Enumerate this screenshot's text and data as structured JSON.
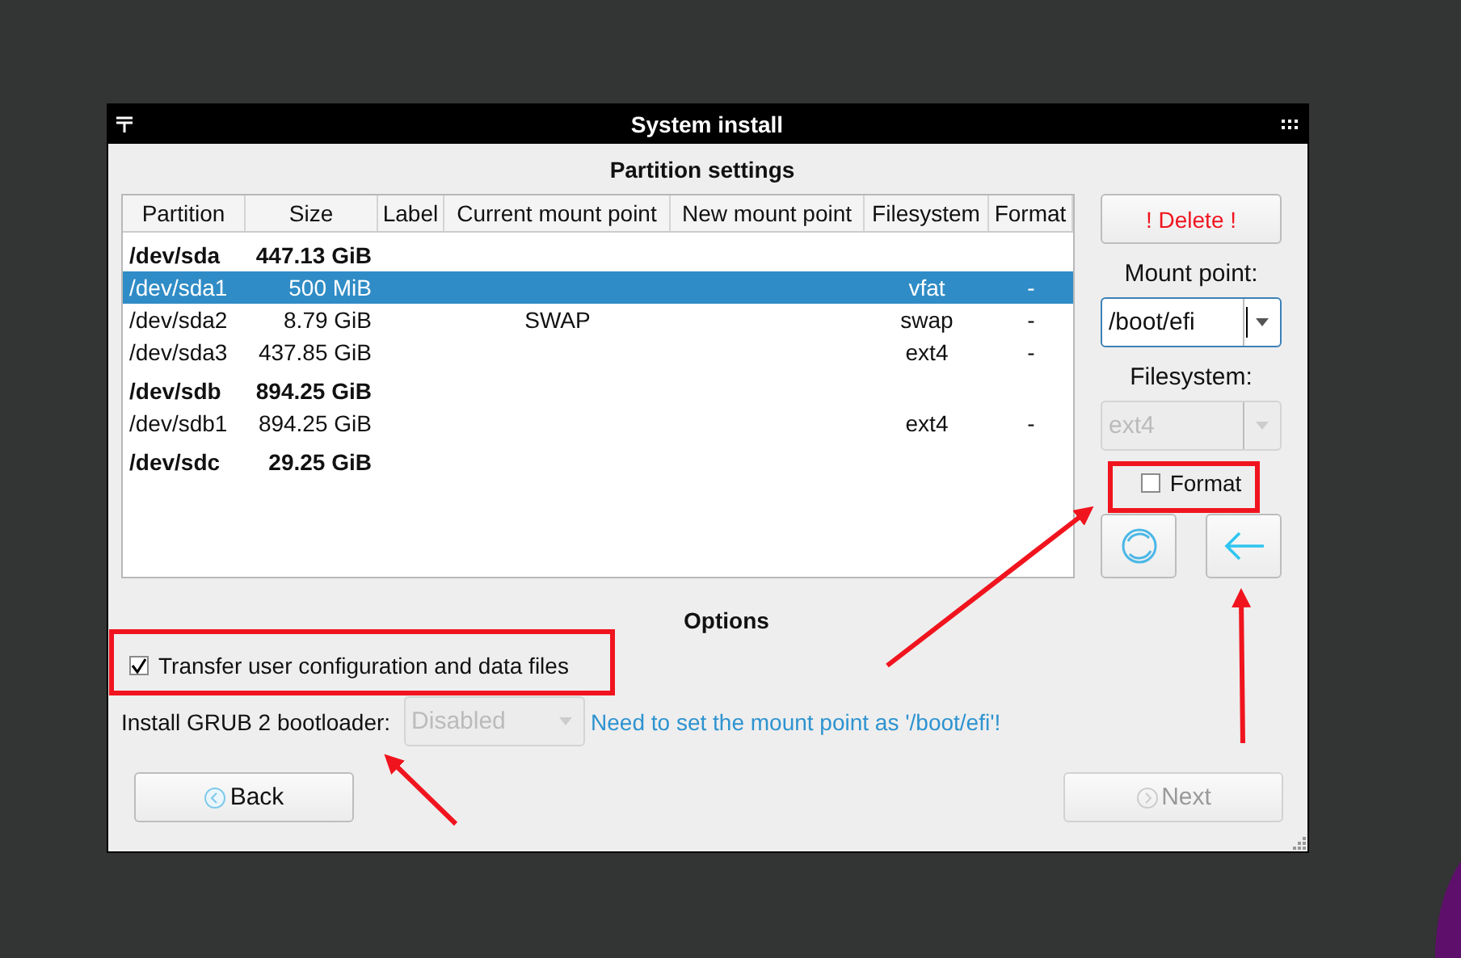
{
  "window": {
    "title": "System install"
  },
  "section_title": "Partition settings",
  "table": {
    "columns": [
      "Partition",
      "Size",
      "Label",
      "Current mount point",
      "New mount point",
      "Filesystem",
      "Format"
    ],
    "rows": [
      {
        "kind": "disk",
        "selected": false,
        "cells": [
          "/dev/sda",
          "447.13 GiB",
          "",
          "",
          "",
          "",
          ""
        ]
      },
      {
        "kind": "partition",
        "selected": true,
        "cells": [
          "/dev/sda1",
          "500 MiB",
          "",
          "",
          "",
          "vfat",
          "-"
        ]
      },
      {
        "kind": "partition",
        "selected": false,
        "cells": [
          "/dev/sda2",
          "8.79 GiB",
          "",
          "SWAP",
          "",
          "swap",
          "-"
        ]
      },
      {
        "kind": "partition",
        "selected": false,
        "cells": [
          "/dev/sda3",
          "437.85 GiB",
          "",
          "",
          "",
          "ext4",
          "-"
        ]
      },
      {
        "kind": "disk",
        "selected": false,
        "cells": [
          "/dev/sdb",
          "894.25 GiB",
          "",
          "",
          "",
          "",
          ""
        ]
      },
      {
        "kind": "partition",
        "selected": false,
        "cells": [
          "/dev/sdb1",
          "894.25 GiB",
          "",
          "",
          "",
          "ext4",
          "-"
        ]
      },
      {
        "kind": "disk",
        "selected": false,
        "cells": [
          "/dev/sdc",
          "29.25 GiB",
          "",
          "",
          "",
          "",
          ""
        ]
      }
    ]
  },
  "side": {
    "delete_button": "! Delete !",
    "mount_point": {
      "label": "Mount point:",
      "value": "/boot/efi"
    },
    "filesystem": {
      "label": "Filesystem:",
      "value": "ext4",
      "disabled": true
    },
    "format": {
      "label": "Format",
      "checked": false
    }
  },
  "options": {
    "title": "Options",
    "transfer": {
      "label": "Transfer user configuration and data files",
      "checked": true
    },
    "grub": {
      "label": "Install GRUB 2 bootloader:",
      "value": "Disabled",
      "disabled": true,
      "hint": "Need to set the mount point as '/boot/efi'!"
    }
  },
  "buttons": {
    "back": {
      "label": "Back",
      "disabled": false
    },
    "next": {
      "label": "Next",
      "disabled": true
    }
  }
}
